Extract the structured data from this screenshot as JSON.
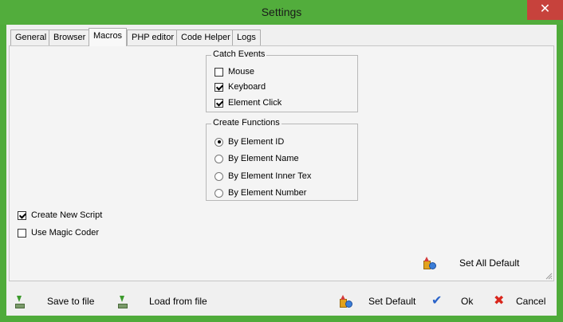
{
  "window": {
    "title": "Settings",
    "close_symbol": "✕"
  },
  "tabs": [
    "General",
    "Browser",
    "Macros",
    "PHP editor",
    "Code Helper",
    "Logs"
  ],
  "active_tab": "Macros",
  "catch_events": {
    "title": "Catch Events",
    "items": [
      {
        "label": "Mouse",
        "checked": false
      },
      {
        "label": "Keyboard",
        "checked": true
      },
      {
        "label": "Element Click",
        "checked": true
      }
    ]
  },
  "create_functions": {
    "title": "Create Functions",
    "items": [
      {
        "label": "By Element ID",
        "selected": true
      },
      {
        "label": "By Element Name",
        "selected": false
      },
      {
        "label": "By Element Inner Tex",
        "selected": false
      },
      {
        "label": "By Element Number",
        "selected": false
      }
    ]
  },
  "options": [
    {
      "label": "Create New Script",
      "checked": true
    },
    {
      "label": "Use Magic Coder",
      "checked": false
    }
  ],
  "buttons": {
    "set_all_default": "Set All Default",
    "save_to_file": "Save to file",
    "load_from_file": "Load from file",
    "set_default": "Set Default",
    "ok": "Ok",
    "cancel": "Cancel"
  },
  "icons": {
    "save": "download-arrow-icon",
    "load": "download-arrow-icon",
    "defaults": "shapes-icon",
    "ok": "checkmark-icon",
    "cancel": "red-x-icon"
  },
  "colors": {
    "titlebar": "#52ad3c",
    "close_button": "#c7423c",
    "ok_icon": "#2a63c9",
    "cancel_icon": "#d9261c"
  }
}
